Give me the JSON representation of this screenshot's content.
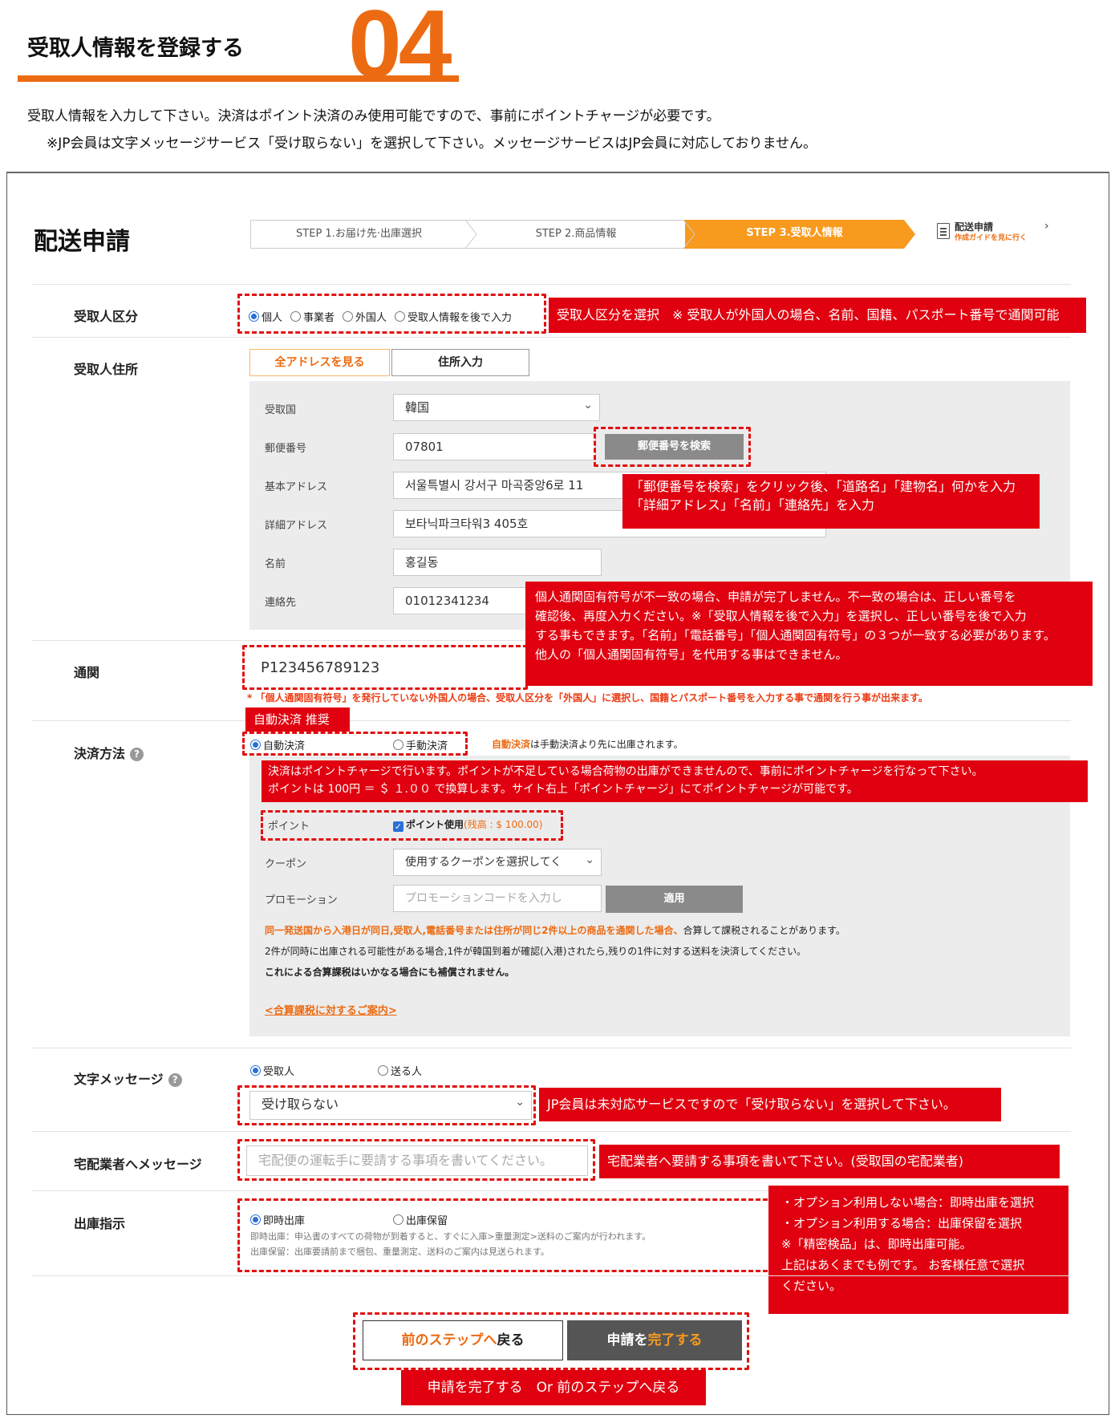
{
  "header": {
    "title": "受取人情報を登録する",
    "step_number": "04",
    "description": "受取人情報を入力して下さい。決済はポイント決済のみ使用可能ですので、事前にポイントチャージが必要です。",
    "note": "※JP会員は文字メッセージサービス「受け取らない」を選択して下さい。メッセージサービスはJP会員に対応しておりません。"
  },
  "panel": {
    "title": "配送申請",
    "steps": [
      "STEP 1.お届け先·出庫選択",
      "STEP 2.商品情報",
      "STEP 3.受取人情報"
    ],
    "active_step": 3,
    "guide": {
      "title": "配送申請",
      "subtitle": "作成ガイドを見に行く"
    }
  },
  "recipient_type": {
    "label": "受取人区分",
    "options": [
      "個人",
      "事業者",
      "外国人",
      "受取人情報を後で入力"
    ],
    "selected": "個人",
    "callout": "受取人区分を選択　※ 受取人が外国人の場合、名前、国籍、パスポート番号で通関可能"
  },
  "address": {
    "label": "受取人住所",
    "tabs": [
      "全アドレスを見る",
      "住所入力"
    ],
    "fields": {
      "country_label": "受取国",
      "country_value": "韓国",
      "postal_label": "郵便番号",
      "postal_value": "07801",
      "postal_search_button": "郵便番号を検索",
      "basic_label": "基本アドレス",
      "basic_value": "서울특별시 강서구 마곡중앙6로 11",
      "detail_label": "詳細アドレス",
      "detail_value": "보타닉파크타워3 405호",
      "name_label": "名前",
      "name_value": "홍길동",
      "contact_label": "連絡先",
      "contact_value": "01012341234"
    },
    "callout_line1": "「郵便番号を検索」をクリック後、「道路名」「建物名」何かを入力",
    "callout_line2": "「詳細アドレス」「名前」「連絡先」を入力"
  },
  "customs": {
    "label": "通関",
    "value": "P123456789123",
    "note": "* 「個人通関固有符号」を発行していない外国人の場合、受取人区分を「外国人」に選択し、国籍とパスポート番号を入力する事で通関を行う事が出来ます。",
    "callout": [
      "個人通関固有符号が不一致の場合、申請が完了しません。不一致の場合は、正しい番号を",
      "確認後、再度入力ください。※「受取人情報を後で入力」を選択し、正しい番号を後で入力",
      "する事もできます。「名前」「電話番号」「個人通関固有符号」の３つが一致する必要があります。",
      "他人の「個人通関固有符号」を代用する事はできません。"
    ]
  },
  "payment": {
    "label": "決済方法",
    "recommend_tag": "自動決済 推奨",
    "options": [
      "自動決済",
      "手動決済"
    ],
    "selected": "自動決済",
    "hint_strong": "自動決済",
    "hint_rest": "は手動決済より先に出庫されます。",
    "callout_line1": "決済はポイントチャージで行います。ポイントが不足している場合荷物の出庫ができませんので、事前にポイントチャージを行なって下さい。",
    "callout_line2": "ポイントは 100円 ＝ ＄ １.００ で換算します。サイト右上「ポイントチャージ」にてポイントチャージが可能です。",
    "point_label": "ポイント",
    "point_checkbox": "ポイント使用",
    "point_balance": "(残高 : $ 100.00)",
    "coupon_label": "クーポン",
    "coupon_placeholder": "使用するクーポンを選択してく",
    "promo_label": "プロモーション",
    "promo_placeholder": "プロモーションコードを入力し",
    "apply_button": "適用",
    "tax_note_orange": "同一発送国から入港日が同日,受取人,電話番号または住所が同じ2件以上の商品を通関した場合、",
    "tax_note_rest": "合算して課税されることがあります。",
    "tax_note2": "2件が同時に出庫される可能性がある場合,1件が韓国到着が確認(入港)されたら,残りの1件に対する送料を決済してください。",
    "tax_note3": "これによる合算課税はいかなる場合にも補償されません。",
    "tax_link": "<合算課税に対するご案内>"
  },
  "sms": {
    "label": "文字メッセージ",
    "options": [
      "受取人",
      "送る人"
    ],
    "selected": "受取人",
    "select_value": "受け取らない",
    "callout": "JP会員は未対応サービスですので「受け取らない」を選択して下さい。"
  },
  "courier": {
    "label": "宅配業者へメッセージ",
    "placeholder": "宅配便の運転手に要請する事項を書いてください。",
    "callout": "宅配業者へ要請する事項を書いて下さい。(受取国の宅配業者)"
  },
  "shipping": {
    "label": "出庫指示",
    "options": [
      "即時出庫",
      "出庫保留"
    ],
    "selected": "即時出庫",
    "desc1": "即時出庫：申込書のすべての荷物が到着すると、すぐに入庫>重量測定>送料のご案内が行われます。",
    "desc2": "出庫保留：出庫要請前まで梱包、重量測定、送料のご案内は見送られます。",
    "callout": [
      "・オプション利用しない場合：即時出庫を選択",
      "・オプション利用する場合：出庫保留を選択",
      "※「精密検品」は、即時出庫可能。",
      "上記はあくまでも例です。 お客様任意で選択",
      "ください。"
    ]
  },
  "buttons": {
    "back_orange": "前のステップへ",
    "back_rest": "戻る",
    "submit_white": "申請を",
    "submit_orange": "完了する",
    "callout": "申請を完了する　Or  前のステップへ戻る"
  },
  "colors": {
    "accent": "#ec6b12",
    "callout_red": "#e0000f",
    "step_active": "#f79a1e"
  }
}
